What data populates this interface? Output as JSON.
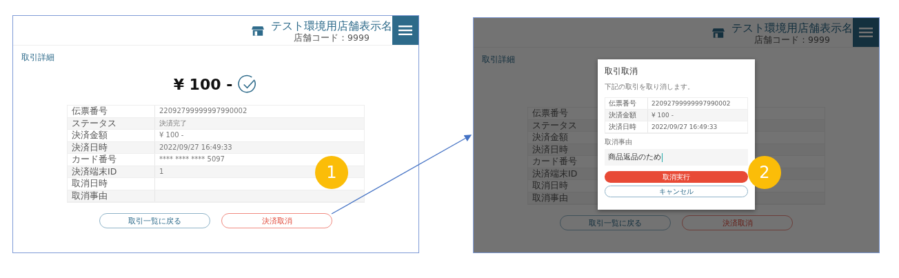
{
  "screens": [
    {
      "header": {
        "store_name": "テスト環境用店舗表示名",
        "store_code": "店舗コード：9999"
      },
      "page_title": "取引詳細",
      "amount": "¥ 100 -",
      "details": [
        {
          "label": "伝票番号",
          "value": "22092799999997990002"
        },
        {
          "label": "ステータス",
          "value": "決済完了"
        },
        {
          "label": "決済金額",
          "value": "¥ 100 -"
        },
        {
          "label": "決済日時",
          "value": "2022/09/27 16:49:33"
        },
        {
          "label": "カード番号",
          "value": "**** **** **** 5097"
        },
        {
          "label": "決済端末ID",
          "value": "1"
        },
        {
          "label": "取消日時"
        },
        {
          "label": "取消事由"
        }
      ],
      "buttons": [
        {
          "label": "取引一覧に戻る",
          "kind": "secondary"
        },
        {
          "label": "決済取消",
          "kind": "danger"
        }
      ],
      "step": "1"
    },
    {
      "header": {
        "store_name": "テスト環境用店舗表示名",
        "store_code": "店舗コード：9999"
      },
      "page_title": "取引詳細",
      "details": [
        {
          "label": "伝票番号"
        },
        {
          "label": "ステータス"
        },
        {
          "label": "決済金額"
        },
        {
          "label": "決済日時"
        },
        {
          "label": "カード番号"
        },
        {
          "label": "決済端末ID"
        },
        {
          "label": "取消日時"
        },
        {
          "label": "取消事由"
        }
      ],
      "buttons": [
        {
          "label": "取引一覧に戻る",
          "kind": "secondary"
        },
        {
          "label": "決済取消",
          "kind": "danger"
        }
      ],
      "dialog": {
        "title": "取引取消",
        "message": "下記の取引を取り消します。",
        "details": [
          {
            "label": "伝票番号",
            "value": "22092799999997990002"
          },
          {
            "label": "決済金額",
            "value": "¥ 100 -"
          },
          {
            "label": "決済日時",
            "value": "2022/09/27 16:49:33"
          }
        ],
        "reason_label": "取消事由",
        "reason_value": "商品返品のため",
        "buttons": [
          {
            "label": "取消実行",
            "kind": "danger"
          },
          {
            "label": "キャンセル",
            "kind": "secondary"
          }
        ]
      },
      "step": "2"
    }
  ]
}
